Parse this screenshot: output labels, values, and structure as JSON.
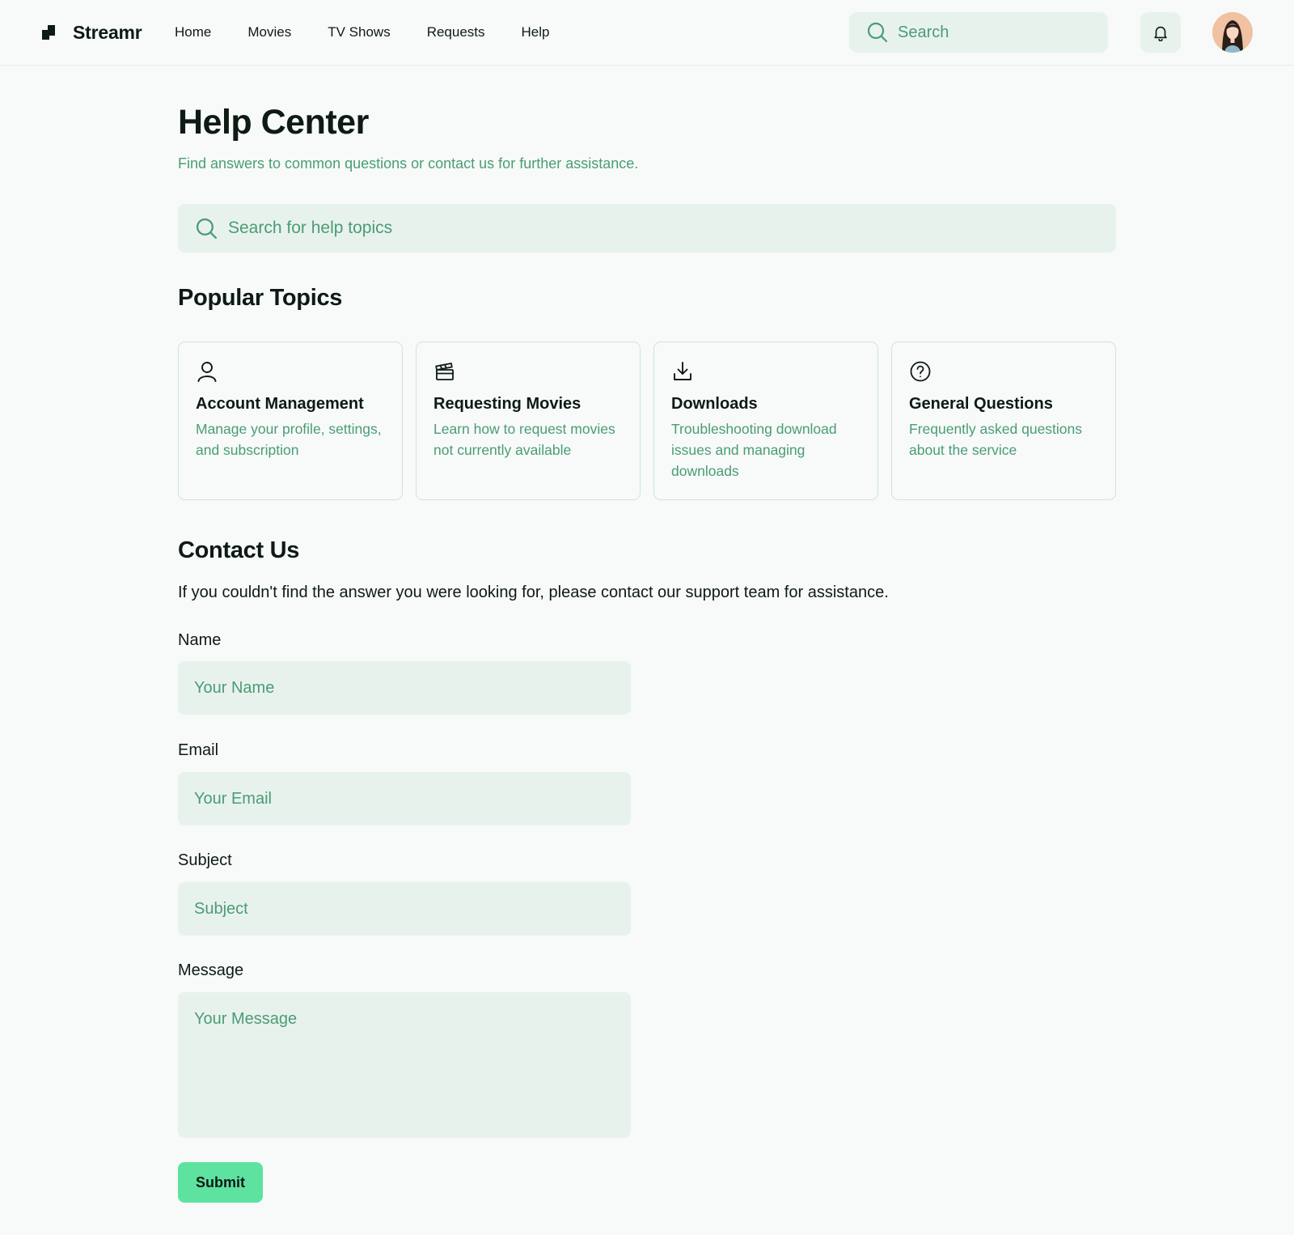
{
  "header": {
    "brand": "Streamr",
    "nav": [
      {
        "label": "Home"
      },
      {
        "label": "Movies"
      },
      {
        "label": "TV Shows"
      },
      {
        "label": "Requests"
      },
      {
        "label": "Help"
      }
    ],
    "search_placeholder": "Search",
    "bell_icon": "bell-icon",
    "avatar_icon": "user-avatar"
  },
  "page": {
    "title": "Help Center",
    "subtitle": "Find answers to common questions or contact us for further assistance.",
    "search_placeholder": "Search for help topics"
  },
  "popular": {
    "title": "Popular Topics",
    "topics": [
      {
        "icon": "user-icon",
        "title": "Account Management",
        "description": "Manage your profile, settings, and subscription"
      },
      {
        "icon": "clapperboard-icon",
        "title": "Requesting Movies",
        "description": "Learn how to request movies not currently available"
      },
      {
        "icon": "download-icon",
        "title": "Downloads",
        "description": "Troubleshooting download issues and managing downloads"
      },
      {
        "icon": "question-icon",
        "title": "General Questions",
        "description": "Frequently asked questions about the service"
      }
    ]
  },
  "contact": {
    "title": "Contact Us",
    "text": "If you couldn't find the answer you were looking for, please contact our support team for assistance.",
    "fields": {
      "name": {
        "label": "Name",
        "placeholder": "Your Name",
        "value": ""
      },
      "email": {
        "label": "Email",
        "placeholder": "Your Email",
        "value": ""
      },
      "subject": {
        "label": "Subject",
        "placeholder": "Subject",
        "value": ""
      },
      "message": {
        "label": "Message",
        "placeholder": "Your Message",
        "value": ""
      }
    },
    "submit_label": "Submit"
  },
  "colors": {
    "accent": "#5ee2a0",
    "muted_text": "#4a9c76",
    "field_bg": "#e8f2ed",
    "page_bg": "#f7faf9",
    "card_border": "#cfe3d9"
  }
}
